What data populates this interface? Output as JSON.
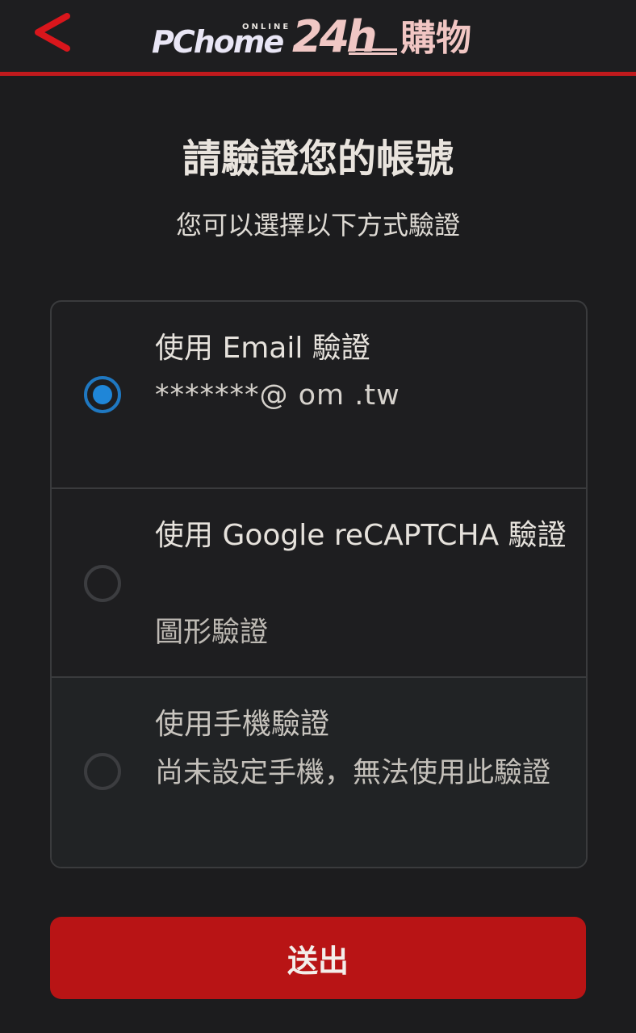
{
  "header": {
    "logo_pc": "PChome",
    "logo_online": "ONLINE",
    "logo_24h": "24h",
    "logo_shop": "購物",
    "accent_color": "#c01a1d"
  },
  "page": {
    "title": "請驗證您的帳號",
    "subtitle": "您可以選擇以下方式驗證"
  },
  "options": [
    {
      "label": "使用 Email 驗證",
      "desc": "*******@                    om .tw",
      "checked": true
    },
    {
      "label": "使用 Google reCAPTCHA 驗證",
      "desc": "圖形驗證",
      "checked": false
    },
    {
      "label": "使用手機驗證",
      "desc": "尚未設定手機，無法使用此驗證",
      "checked": false,
      "disabled": true
    }
  ],
  "submit": {
    "label": "送出",
    "color": "#b81415"
  }
}
